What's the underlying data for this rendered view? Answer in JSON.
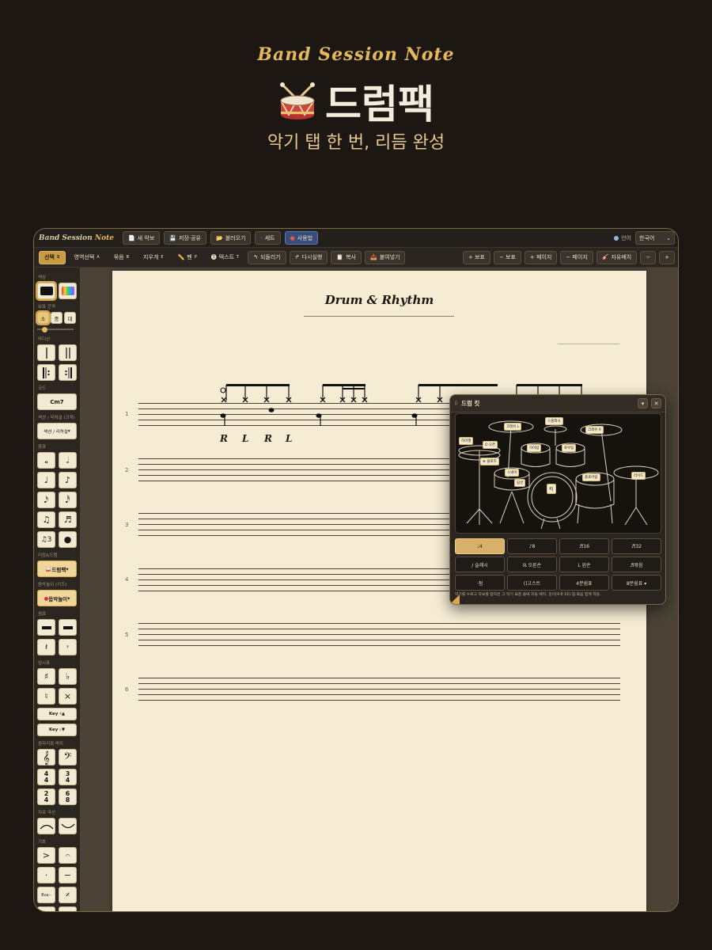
{
  "hero": {
    "brand": "Band Session Note",
    "title": "드럼팩",
    "subtitle": "악기 탭 한 번, 리듬 완성"
  },
  "topbar": {
    "app_name_main": "Band Session",
    "app_name_accent": "Note",
    "buttons": [
      "새 악보",
      "저장·공유",
      "불러오기",
      "세트",
      "사용법"
    ],
    "language_label": "언어",
    "language_value": "한국어"
  },
  "toolbar": {
    "left": [
      "선택",
      "영역선택",
      "묶음",
      "지우개",
      "펜",
      "텍스트",
      "되돌리기",
      "다시실행",
      "복사",
      "붙여넣기"
    ],
    "left_shortcuts": [
      "S",
      "A",
      "B",
      "E",
      "P",
      "T"
    ],
    "right": [
      "+ 보표",
      "− 보표",
      "+ 페이지",
      "− 페이지",
      "자유배치",
      "−",
      "+"
    ]
  },
  "sidebar": {
    "color_label": "색상",
    "spacing_label": "보표 간격",
    "spacing_options": [
      "소",
      "중",
      "대"
    ],
    "barline_label": "마디선",
    "chord_label": "코드",
    "chord_value": "Cm7",
    "section_label": "섹션 / 리허설 (크게)",
    "section_value": "섹션 / 리허설",
    "notes_label": "음표",
    "rhythm_label": "리듬&드럼",
    "rhythm_value": "드럼팩",
    "instrument_label": "음악놀이 (키즈)",
    "instrument_value": "음악놀이",
    "rest_label": "쉼표",
    "accidental_label": "임시표",
    "key_up": "Key ♯▲",
    "key_down": "Key ♭▼",
    "clef_label": "음자리표·박자",
    "time_sigs": [
      [
        "4",
        "4"
      ],
      [
        "3",
        "4"
      ],
      [
        "2",
        "4"
      ],
      [
        "6",
        "8"
      ]
    ],
    "curve_label": "자유 곡선",
    "symbol_label": "기호",
    "symbol_8va": "8va--"
  },
  "score": {
    "title": "Drum & Rhythm",
    "staff_numbers": [
      "1",
      "2",
      "3",
      "4",
      "5",
      "6"
    ],
    "sticking": [
      "R",
      "L",
      "R",
      "L"
    ]
  },
  "drum_panel": {
    "title": "드럼 킷",
    "kit_labels": [
      "크래쉬 L",
      "스플래시",
      "크래쉬 R",
      "하이햇",
      "O 오픈",
      "⊕ 클로즈",
      "하이탐",
      "로우탐",
      "스네어",
      "림샷",
      "플로어탐",
      "라이드",
      "킥"
    ],
    "durations": [
      "♩4",
      "♪8",
      "♬16",
      "♬32"
    ],
    "techniques": [
      "/ 슬래시",
      "ℝ 오른손",
      "L 왼손",
      "♬묶음"
    ],
    "others": [
      "·점",
      "()고스트",
      "4분쉼표",
      "8분쉼표 ▾"
    ],
    "hint": "악기를 누르고 악보를 탭하면 그 악기 표준 줄에 자동 배치. 길이(4·8·16)·점·묶음 함께 적용."
  }
}
